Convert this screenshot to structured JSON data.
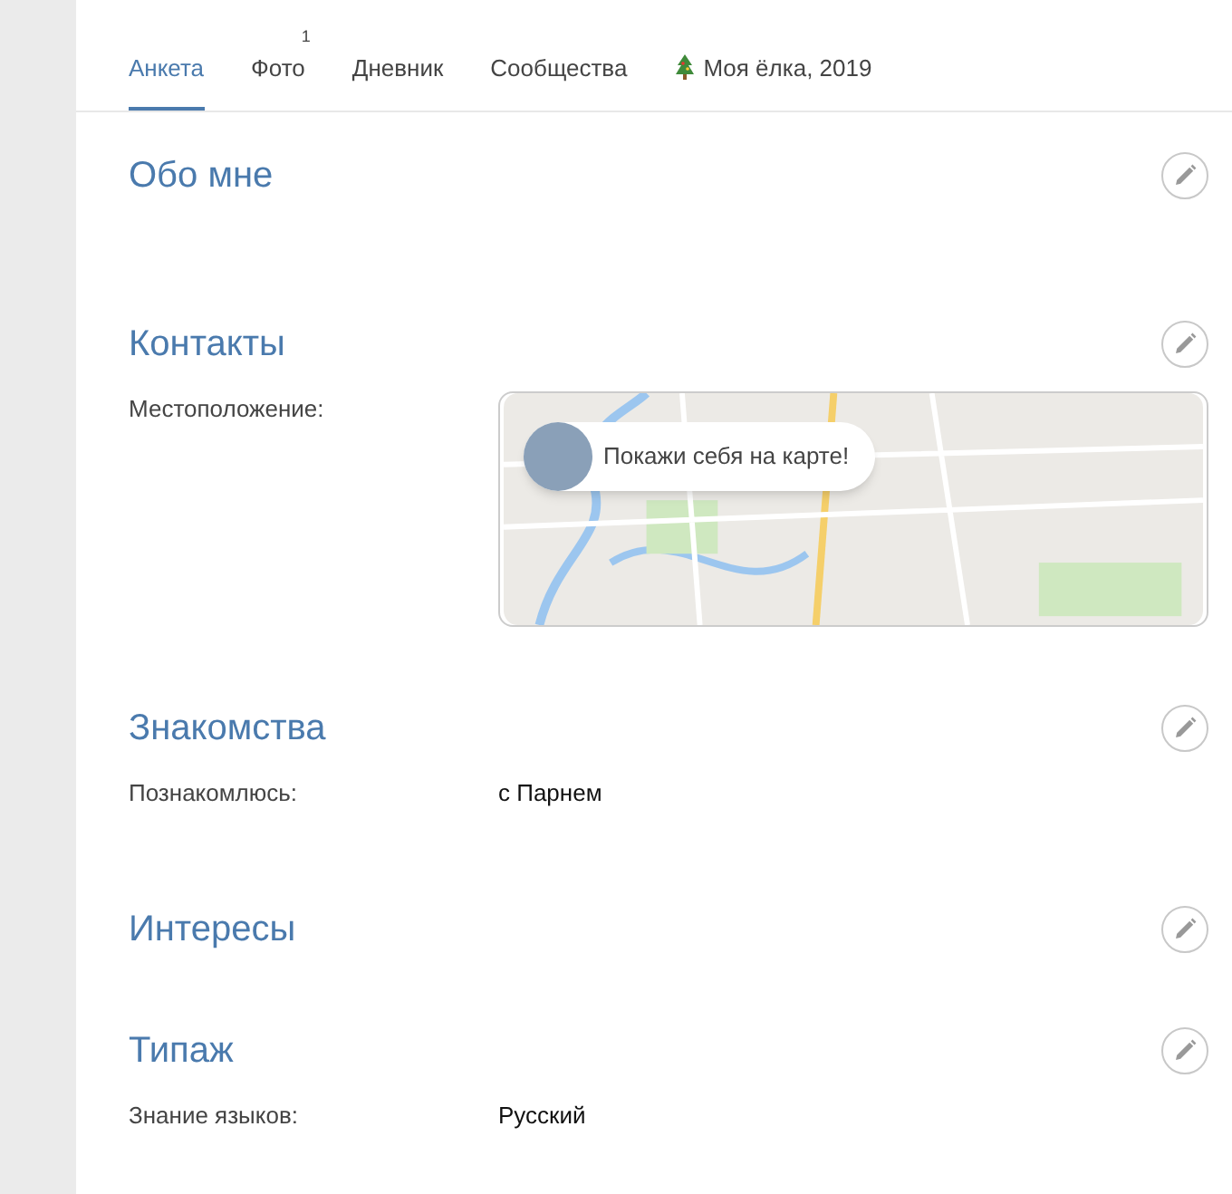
{
  "tabs": [
    {
      "label": "Анкета",
      "selected": true
    },
    {
      "label": "Фото",
      "selected": false,
      "badge": "1"
    },
    {
      "label": "Дневник",
      "selected": false
    },
    {
      "label": "Сообщества",
      "selected": false
    },
    {
      "label": "Моя ёлка, 2019",
      "selected": false,
      "kind": "tree"
    }
  ],
  "sections": [
    {
      "title": "Обо мне"
    },
    {
      "title": "Контакты",
      "rows": [
        {
          "kind": "map",
          "label": "Местоположение:",
          "popup": "Покажи себя на карте!"
        }
      ]
    },
    {
      "title": "Знакомства",
      "rows": [
        {
          "kind": "text",
          "label": "Познакомлюсь:",
          "value": "с Парнем"
        }
      ]
    },
    {
      "title": "Интересы"
    },
    {
      "title": "Типаж",
      "rows": [
        {
          "kind": "text",
          "label": "Знание языков:",
          "value": "Русский"
        }
      ]
    }
  ]
}
